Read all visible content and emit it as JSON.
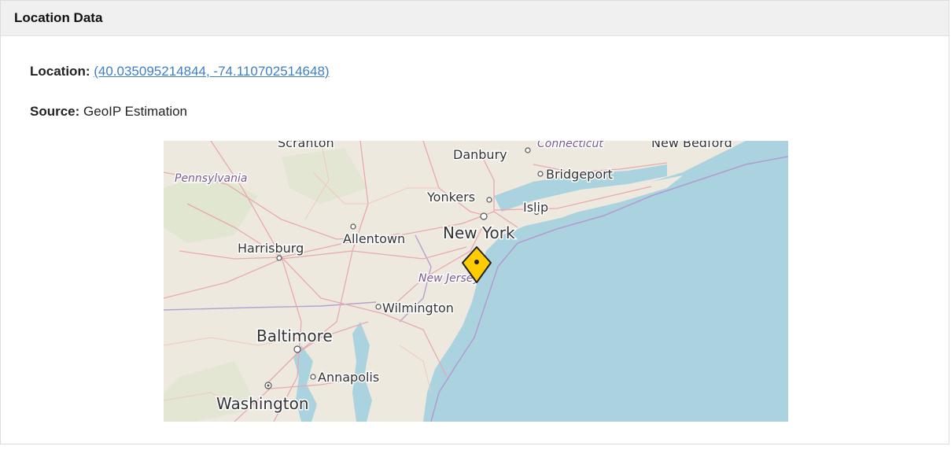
{
  "panel": {
    "title": "Location Data"
  },
  "location": {
    "label": "Location:",
    "value": "(40.035095214844, -74.110702514648)"
  },
  "source": {
    "label": "Source:",
    "value": "GeoIP Estimation"
  },
  "map": {
    "cities": {
      "scranton": "Scranton",
      "danbury": "Danbury",
      "bridgeport": "Bridgeport",
      "new_bedford": "New Bedford",
      "yonkers": "Yonkers",
      "islip": "Islip",
      "new_york": "New York",
      "harrisburg": "Harrisburg",
      "allentown": "Allentown",
      "wilmington": "Wilmington",
      "baltimore": "Baltimore",
      "annapolis": "Annapolis",
      "washington": "Washington"
    },
    "states": {
      "pennsylvania": "Pennsylvania",
      "new_jersey": "New Jersey",
      "connecticut": "Connecticut"
    },
    "marker_icon": "map-pin-icon",
    "colors": {
      "water": "#aad3df",
      "land": "#ede9df",
      "marker": "#ffcc00"
    }
  }
}
